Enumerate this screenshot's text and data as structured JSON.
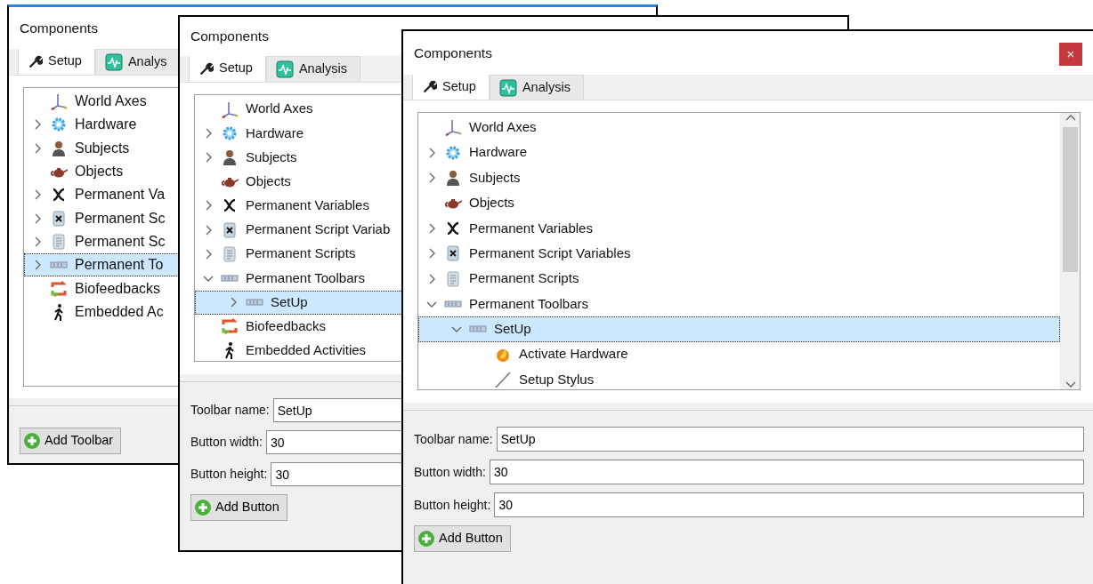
{
  "windows": [
    {
      "title": "Components",
      "tabs": [
        {
          "label": "Setup",
          "kind": "wrench",
          "selected": true
        },
        {
          "label": "Analys",
          "kind": "wave",
          "selected": false
        }
      ],
      "tree": [
        {
          "label": "World Axes",
          "kind": "axes",
          "selected": false
        },
        {
          "label": "Hardware",
          "kind": "gear",
          "expanded": false,
          "selected": false
        },
        {
          "label": "Subjects",
          "kind": "person",
          "expanded": false,
          "selected": false
        },
        {
          "label": "Objects",
          "kind": "teapot",
          "selected": false
        },
        {
          "label": "Permanent Va",
          "kind": "variable",
          "expanded": false,
          "selected": false
        },
        {
          "label": "Permanent Sc",
          "kind": "scriptvar",
          "expanded": false,
          "selected": false
        },
        {
          "label": "Permanent Sc",
          "kind": "script",
          "expanded": false,
          "selected": false
        },
        {
          "label": "Permanent To",
          "kind": "toolbar",
          "expanded": false,
          "selected": true
        },
        {
          "label": "Biofeedbacks",
          "kind": "loop",
          "selected": false
        },
        {
          "label": "Embedded Ac",
          "kind": "walker",
          "selected": false
        }
      ],
      "action": "Add Toolbar"
    },
    {
      "title": "Components",
      "tabs": [
        {
          "label": "Setup",
          "kind": "wrench",
          "selected": true
        },
        {
          "label": "Analysis",
          "kind": "wave",
          "selected": false
        }
      ],
      "tree": [
        {
          "label": "World Axes",
          "kind": "axes",
          "selected": false
        },
        {
          "label": "Hardware",
          "kind": "gear",
          "expanded": false,
          "selected": false
        },
        {
          "label": "Subjects",
          "kind": "person",
          "expanded": false,
          "selected": false
        },
        {
          "label": "Objects",
          "kind": "teapot",
          "selected": false
        },
        {
          "label": "Permanent Variables",
          "kind": "variable",
          "expanded": false,
          "selected": false
        },
        {
          "label": "Permanent Script Variab",
          "kind": "scriptvar",
          "expanded": false,
          "selected": false
        },
        {
          "label": "Permanent Scripts",
          "kind": "script",
          "expanded": false,
          "selected": false
        },
        {
          "label": "Permanent Toolbars",
          "kind": "toolbar",
          "expanded": true,
          "selected": false,
          "children": [
            {
              "label": "SetUp",
              "kind": "toolbar",
              "expanded": false,
              "selected": true
            }
          ]
        },
        {
          "label": "Biofeedbacks",
          "kind": "loop",
          "selected": false
        },
        {
          "label": "Embedded Activities",
          "kind": "walker",
          "selected": false
        }
      ],
      "fields": [
        {
          "label": "Toolbar name:",
          "value": "SetUp"
        },
        {
          "label": "Button width:",
          "value": "30"
        },
        {
          "label": "Button height:",
          "value": "30"
        }
      ],
      "action": "Add Button"
    },
    {
      "title": "Components",
      "close": "×",
      "tabs": [
        {
          "label": "Setup",
          "kind": "wrench",
          "selected": true
        },
        {
          "label": "Analysis",
          "kind": "wave",
          "selected": false
        }
      ],
      "tree": [
        {
          "label": "World Axes",
          "kind": "axes",
          "selected": false
        },
        {
          "label": "Hardware",
          "kind": "gear",
          "expanded": false,
          "selected": false
        },
        {
          "label": "Subjects",
          "kind": "person",
          "expanded": false,
          "selected": false
        },
        {
          "label": "Objects",
          "kind": "teapot",
          "selected": false
        },
        {
          "label": "Permanent Variables",
          "kind": "variable",
          "expanded": false,
          "selected": false
        },
        {
          "label": "Permanent Script Variables",
          "kind": "scriptvar",
          "expanded": false,
          "selected": false
        },
        {
          "label": "Permanent Scripts",
          "kind": "script",
          "expanded": false,
          "selected": false
        },
        {
          "label": "Permanent Toolbars",
          "kind": "toolbar",
          "expanded": true,
          "selected": false,
          "children": [
            {
              "label": "SetUp",
              "kind": "toolbar",
              "expanded": true,
              "selected": true,
              "children": [
                {
                  "label": "Activate Hardware",
                  "kind": "flame",
                  "selected": false
                },
                {
                  "label": "Setup Stylus",
                  "kind": "stylus",
                  "selected": false
                }
              ]
            }
          ]
        }
      ],
      "fields": [
        {
          "label": "Toolbar name:",
          "value": "SetUp"
        },
        {
          "label": "Button width:",
          "value": "30"
        },
        {
          "label": "Button height:",
          "value": "30"
        }
      ],
      "action": "Add Button"
    }
  ]
}
